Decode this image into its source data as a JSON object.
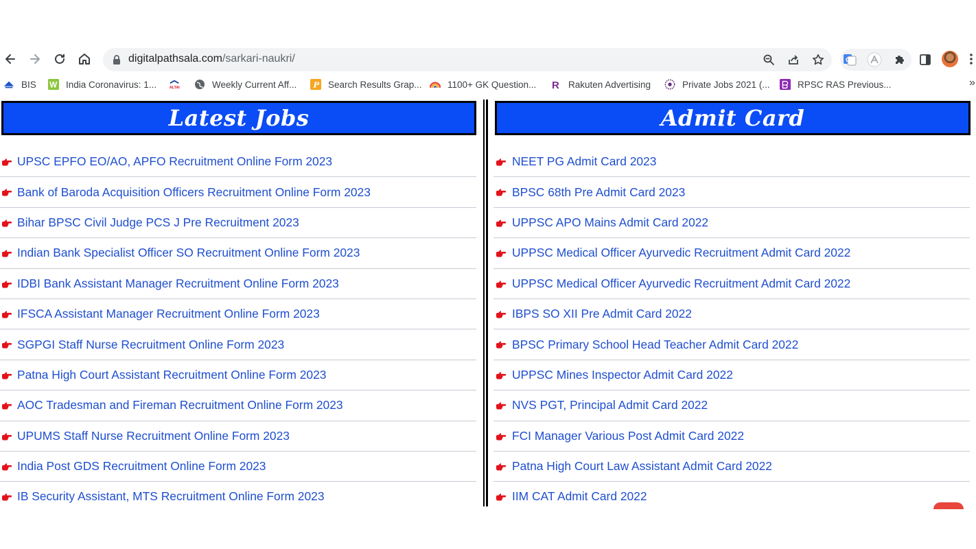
{
  "browser": {
    "url_domain": "digitalpathsala.com",
    "url_path": "/sarkari-naukri/",
    "bookmarks": [
      {
        "label": "BIS",
        "icon": "bis-icon",
        "color": "#1e57c8"
      },
      {
        "label": "India Coronavirus: 1...",
        "icon": "w-icon",
        "color": "#8dc63f"
      },
      {
        "label": "",
        "icon": "altai-icon",
        "color": "#1a3c9c"
      },
      {
        "label": "Weekly Current Aff...",
        "icon": "globe-icon",
        "color": "#5f6368"
      },
      {
        "label": "Search Results Grap...",
        "icon": "p-icon",
        "color": "#f5a623"
      },
      {
        "label": "1100+ GK Question...",
        "icon": "rainbow-icon",
        "color": "#e8453c"
      },
      {
        "label": "Rakuten Advertising",
        "icon": "r-icon",
        "color": "#7b2c8e"
      },
      {
        "label": "Private Jobs 2021 (...",
        "icon": "badge-icon",
        "color": "#5f2d7a"
      },
      {
        "label": "RPSC RAS Previous...",
        "icon": "book-icon",
        "color": "#8e2bb3"
      }
    ],
    "more_label": "»"
  },
  "latest_jobs": {
    "title": "Latest Jobs",
    "items": [
      "UPSC EPFO EO/AO, APFO Recruitment Online Form 2023",
      "Bank of Baroda Acquisition Officers Recruitment Online Form 2023",
      "Bihar BPSC Civil Judge PCS J Pre Recruitment 2023",
      "Indian Bank Specialist Officer SO Recruitment Online Form 2023",
      "IDBI Bank Assistant Manager Recruitment Online Form 2023",
      "IFSCA Assistant Manager Recruitment Online Form 2023",
      "SGPGI Staff Nurse Recruitment Online Form 2023",
      "Patna High Court Assistant Recruitment Online Form 2023",
      "AOC Tradesman and Fireman Recruitment Online Form 2023",
      "UPUMS Staff Nurse Recruitment Online Form 2023",
      "India Post GDS Recruitment Online Form 2023",
      "IB Security Assistant, MTS Recruitment Online Form 2023"
    ]
  },
  "admit_card": {
    "title": "Admit Card",
    "items": [
      "NEET PG Admit Card 2023",
      "BPSC 68th Pre Admit Card 2023",
      "UPPSC APO Mains Admit Card 2022",
      "UPPSC Medical Officer Ayurvedic Recruitment Admit Card 2022",
      "UPPSC Medical Officer Ayurvedic Recruitment Admit Card 2022",
      "IBPS SO XII Pre Admit Card 2022",
      "BPSC Primary School Head Teacher Admit Card 2022",
      "UPPSC Mines Inspector Admit Card 2022",
      "NVS PGT, Principal Admit Card 2022",
      "FCI Manager Various Post Admit Card 2022",
      "Patna High Court Law Assistant Admit Card 2022",
      "IIM CAT Admit Card 2022"
    ]
  },
  "colors": {
    "header_blue": "#0a4cf5",
    "link_blue": "#1f4fcf",
    "hand_red": "#e3121b"
  }
}
